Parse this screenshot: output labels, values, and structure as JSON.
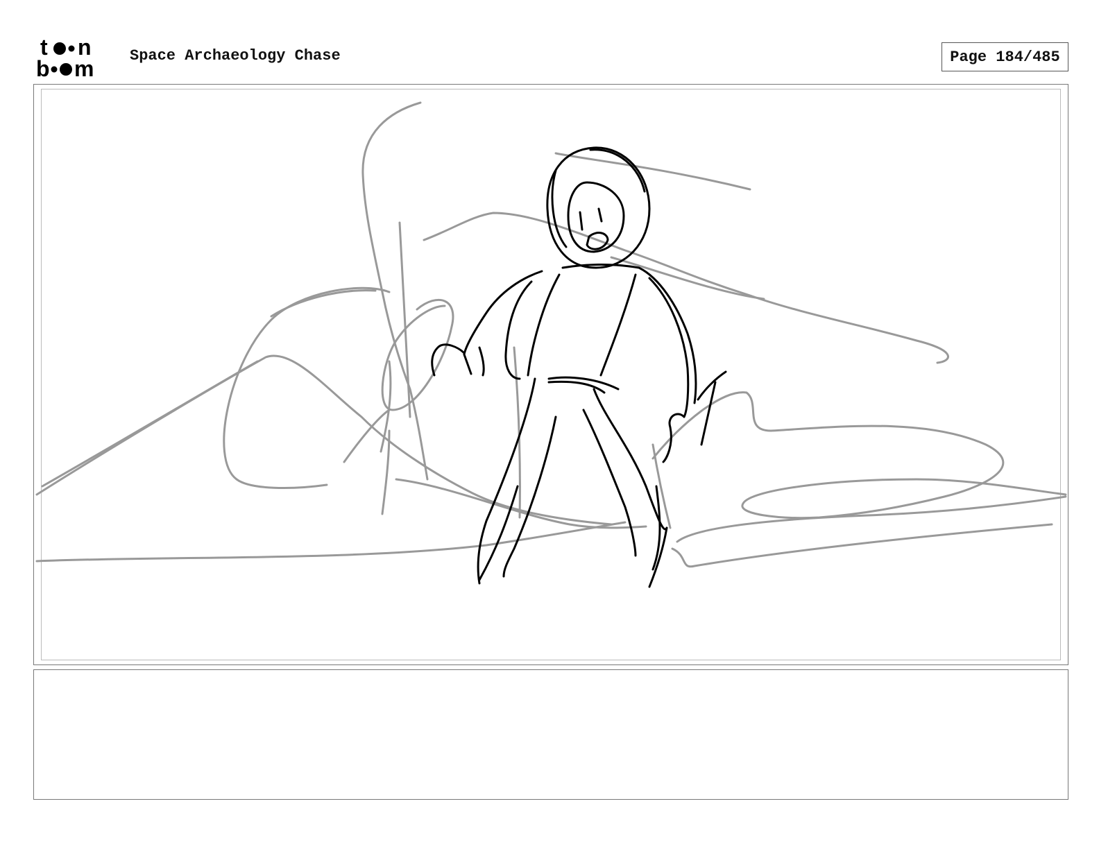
{
  "header": {
    "logo_name": "toon boom logo",
    "project_title": "Space Archaeology Chase",
    "page_label": "Page 184/485"
  },
  "panel": {
    "sketch_name": "astronaut-rough-sketch"
  },
  "notes": {
    "text": ""
  }
}
